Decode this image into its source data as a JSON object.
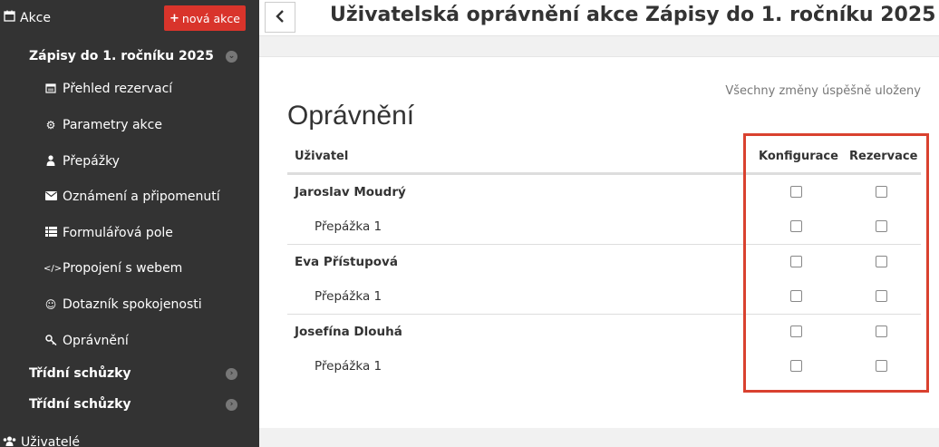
{
  "sidebar": {
    "section_title": "Akce",
    "new_button": "nová akce",
    "event_title": "Zápisy do 1. ročníku 2025",
    "items": [
      {
        "label": "Přehled rezervací",
        "icon": "calendar-icon"
      },
      {
        "label": "Parametry akce",
        "icon": "gears-icon"
      },
      {
        "label": "Přepážky",
        "icon": "user-icon"
      },
      {
        "label": "Oznámení a připomenutí",
        "icon": "envelope-icon"
      },
      {
        "label": "Formulářová pole",
        "icon": "list-icon"
      },
      {
        "label": "Propojení s webem",
        "icon": "code-icon"
      },
      {
        "label": "Dotazník spokojenosti",
        "icon": "smile-icon"
      },
      {
        "label": "Oprávnění",
        "icon": "key-icon"
      }
    ],
    "other_events": [
      "Třídní schůzky",
      "Třídní schůzky"
    ],
    "users_label": "Uživatelé"
  },
  "header": {
    "title": "Uživatelská oprávnění akce Zápisy do 1. ročníku 2025"
  },
  "main": {
    "save_status": "Všechny změny úspěšně uloženy",
    "section_title": "Oprávnění",
    "columns": {
      "user": "Uživatel",
      "config": "Konfigurace",
      "reservation": "Rezervace"
    },
    "rows": [
      {
        "name": "Jaroslav Moudrý",
        "type": "user",
        "config": false,
        "reservation": false
      },
      {
        "name": "Přepážka 1",
        "type": "sub",
        "config": false,
        "reservation": false
      },
      {
        "name": "Eva Přístupová",
        "type": "user",
        "config": false,
        "reservation": false
      },
      {
        "name": "Přepážka 1",
        "type": "sub",
        "config": false,
        "reservation": false
      },
      {
        "name": "Josefína Dlouhá",
        "type": "user",
        "config": false,
        "reservation": false
      },
      {
        "name": "Přepážka 1",
        "type": "sub",
        "config": false,
        "reservation": false
      }
    ]
  },
  "colors": {
    "sidebar_bg": "#333333",
    "accent_red": "#d9342b",
    "highlight": "#d9412f"
  }
}
